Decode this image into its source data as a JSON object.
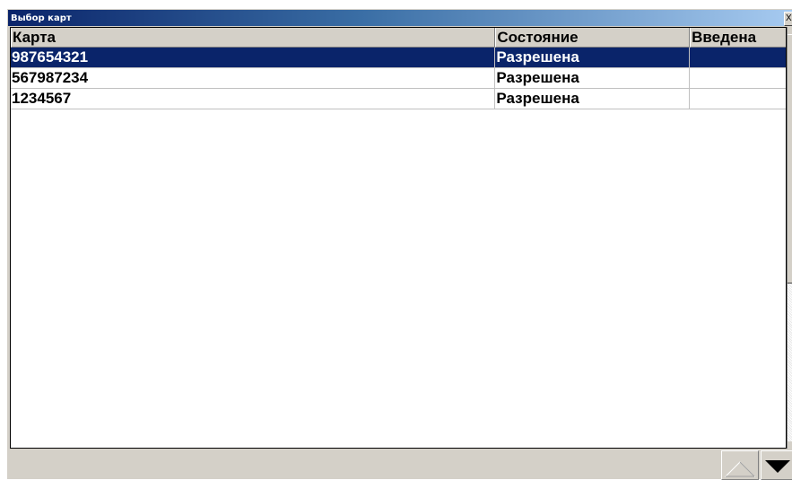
{
  "window": {
    "title": "Выбор карт",
    "close_label": "X"
  },
  "table": {
    "columns": [
      "Карта",
      "Состояние",
      "Введена"
    ],
    "rows": [
      {
        "card": "987654321",
        "status": "Разрешена",
        "entered": "",
        "selected": true
      },
      {
        "card": "567987234",
        "status": "Разрешена",
        "entered": "",
        "selected": false
      },
      {
        "card": "1234567",
        "status": "Разрешена",
        "entered": "",
        "selected": false
      }
    ]
  },
  "navigation": {
    "up_icon": "triangle-up-outline-icon",
    "down_icon": "triangle-down-filled-icon"
  },
  "colors": {
    "selection": "#0a246a",
    "title_gradient_start": "#0a246a",
    "title_gradient_end": "#a6caf0",
    "window_bg": "#d4d0c8"
  }
}
